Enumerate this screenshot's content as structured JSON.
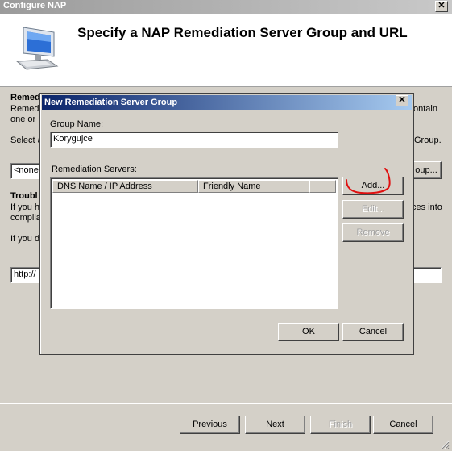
{
  "window": {
    "title": "Configure NAP",
    "close_glyph": "✕"
  },
  "header": {
    "title": "Specify a NAP Remediation Server Group and URL",
    "icon": "monitor-icon"
  },
  "background": {
    "section1_heading": "Remed",
    "section1_line1": "Remedi",
    "section1_line1_tail": "ontain",
    "section1_line2": "one or n",
    "select_prefix": "Select a",
    "select_tail": "Group.",
    "group_select_value": "<none>",
    "group_button_label": "oup...",
    "section2_heading": "Troubl",
    "section2_line1": "If you ha",
    "section2_line1_tail": "ces into",
    "section2_line2": "complia",
    "section2_line3": "If you d",
    "url_value": "http://"
  },
  "dialog": {
    "title": "New Remediation Server Group",
    "close_glyph": "✕",
    "group_name_label": "Group Name:",
    "group_name_value": "Korygujce",
    "servers_label": "Remediation Servers:",
    "columns": [
      "DNS Name / IP Address",
      "Friendly Name"
    ],
    "rows": [],
    "add_button": "Add...",
    "edit_button": "Edit...",
    "remove_button": "Remove",
    "ok_button": "OK",
    "cancel_button": "Cancel"
  },
  "footer": {
    "previous": "Previous",
    "next": "Next",
    "finish": "Finish",
    "cancel": "Cancel"
  },
  "colors": {
    "dialog_title_start": "#0a246a",
    "dialog_title_end": "#a6caf0",
    "face": "#d4d0c8",
    "annotation": "#e01010"
  }
}
